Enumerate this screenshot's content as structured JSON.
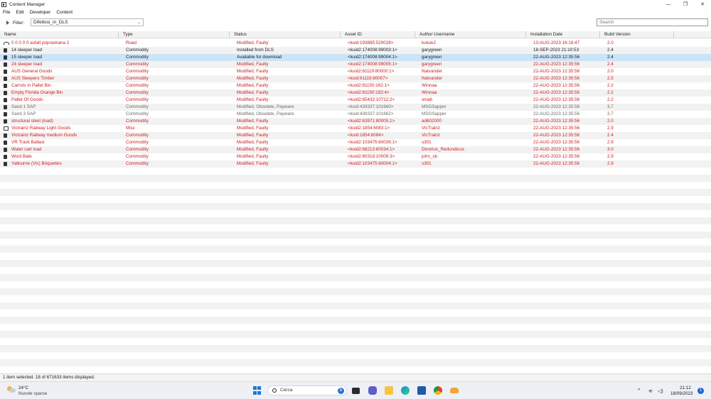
{
  "window": {
    "title": "Content Manager",
    "controls": {
      "minimize": "—",
      "maximize": "❐",
      "close": "✕"
    }
  },
  "menu": [
    "File",
    "Edit",
    "Developer",
    "Content"
  ],
  "filter": {
    "label": "Filter:",
    "value": "Difettosi_in_DLS",
    "search_placeholder": "Search"
  },
  "columns": [
    "Name",
    "Type",
    "Status",
    "Asset ID",
    "Author Username",
    "Installation Date",
    "Build Version"
  ],
  "colors": {
    "faulty": "#d21a1a",
    "normal": "#1a1a1a",
    "obsolete": "#6a6a6a",
    "selected": "#cce4f7"
  },
  "rows": [
    {
      "name": "0 0 0 0 0 asfalt popraskana 2",
      "type": "Road",
      "status": "Modified, Faulty",
      "asset_id": "<kuid:193885:520028>",
      "author": "kukuk2",
      "date": "13-AUG-2023 16:16:47",
      "version": "2.0",
      "icon": "road-icon",
      "color": "faulty"
    },
    {
      "name": "14 sleeper load",
      "type": "Commodity",
      "status": "Installed from DLS",
      "asset_id": "<kuid2:174008:99003:1>",
      "author": "garygreen",
      "date": "18-SEP-2023 21:10:53",
      "version": "2.4",
      "icon": "commodity-icon",
      "color": "normal"
    },
    {
      "name": "15 sleeper load",
      "type": "Commodity",
      "status": "Available for download",
      "asset_id": "<kuid2:174008:99004:1>",
      "author": "garygreen",
      "date": "22-AUG-2023 12:35:56",
      "version": "2.4",
      "icon": "commodity-icon",
      "color": "normal",
      "selected": true
    },
    {
      "name": "24 sleeper load",
      "type": "Commodity",
      "status": "Modified, Faulty",
      "asset_id": "<kuid2:174008:99005:1>",
      "author": "garygreen",
      "date": "22-AUG-2023 12:35:56",
      "version": "2.4",
      "icon": "commodity-icon",
      "color": "faulty"
    },
    {
      "name": "AUS General Goods",
      "type": "Commodity",
      "status": "Modified, Faulty",
      "asset_id": "<kuid2:61119:80000:1>",
      "author": "Natvander",
      "date": "22-AUG-2023 12:35:56",
      "version": "2.0",
      "icon": "commodity-icon",
      "color": "faulty"
    },
    {
      "name": "AUS Sleepers Timber",
      "type": "Commodity",
      "status": "Modified, Faulty",
      "asset_id": "<kuid:61119:80007>",
      "author": "Natvander",
      "date": "22-AUG-2023 12:35:56",
      "version": "2.5",
      "icon": "commodity-icon",
      "color": "faulty"
    },
    {
      "name": "Carrots in Pallet Bin",
      "type": "Commodity",
      "status": "Modified, Faulty",
      "asset_id": "<kuid2:81150:162:1>",
      "author": "Winnaa",
      "date": "22-AUG-2023 12:35:56",
      "version": "2.2",
      "icon": "commodity-icon",
      "color": "faulty"
    },
    {
      "name": "Empty Florida Orange Bin",
      "type": "Commodity",
      "status": "Modified, Faulty",
      "asset_id": "<kuid2:81150:192:4>",
      "author": "Winnaa",
      "date": "22-AUG-2023 12:35:56",
      "version": "2.2",
      "icon": "commodity-icon",
      "color": "faulty"
    },
    {
      "name": "Pallet Of Goods",
      "type": "Commodity",
      "status": "Modified, Faulty",
      "asset_id": "<kuid2:65432:10712:2>",
      "author": "sinab",
      "date": "22-AUG-2023 12:35:56",
      "version": "2.2",
      "icon": "commodity-icon",
      "color": "faulty"
    },
    {
      "name": "Sand 1 SAP",
      "type": "Commodity",
      "status": "Modified, Obsolete, Payware",
      "asset_id": "<kuid:439337:101660>",
      "author": "MSGSapper",
      "date": "22-AUG-2023 12:35:56",
      "version": "3.7",
      "icon": "commodity-icon",
      "color": "obsolete"
    },
    {
      "name": "Sand 3 SAP",
      "type": "Commodity",
      "status": "Modified, Obsolete, Payware",
      "asset_id": "<kuid:439337:101662>",
      "author": "MSGSapper",
      "date": "22-AUG-2023 12:35:56",
      "version": "3.7",
      "icon": "commodity-icon",
      "color": "obsolete"
    },
    {
      "name": "structural steel (load)",
      "type": "Commodity",
      "status": "Modified, Faulty",
      "asset_id": "<kuid2:63971:80005:1>",
      "author": "ad602000",
      "date": "22-AUG-2023 12:35:56",
      "version": "2.0",
      "icon": "commodity-icon",
      "color": "faulty"
    },
    {
      "name": "Victrainz Railway Light Goods",
      "type": "Misc",
      "status": "Modified, Faulty",
      "asset_id": "<kuid2:1854:6083:1>",
      "author": "VicTrainz",
      "date": "22-AUG-2023 12:35:56",
      "version": "2.9",
      "icon": "misc-icon",
      "color": "faulty"
    },
    {
      "name": "Victrainz Railway medium Goods",
      "type": "Commodity",
      "status": "Modified, Faulty",
      "asset_id": "<kuid:1854:6084>",
      "author": "VicTrainz",
      "date": "22-AUG-2023 12:35:56",
      "version": "2.4",
      "icon": "commodity-icon",
      "color": "faulty"
    },
    {
      "name": "VR Track Ballast",
      "type": "Commodity",
      "status": "Modified, Faulty",
      "asset_id": "<kuid2:103475:60026:1>",
      "author": "s301",
      "date": "22-AUG-2023 12:35:56",
      "version": "2.9",
      "icon": "commodity-icon",
      "color": "faulty"
    },
    {
      "name": "Water cart load",
      "type": "Commodity",
      "status": "Modified, Faulty",
      "asset_id": "<kuid2:68213:60034:1>",
      "author": "Dinorius_Redundicus",
      "date": "22-AUG-2023 12:35:56",
      "version": "3.0",
      "icon": "commodity-icon",
      "color": "faulty"
    },
    {
      "name": "Wool Bale",
      "type": "Commodity",
      "status": "Modified, Faulty",
      "asset_id": "<kuid2:60318:10009:3>",
      "author": "john_sb",
      "date": "22-AUG-2023 12:35:56",
      "version": "2.9",
      "icon": "commodity-icon",
      "color": "faulty"
    },
    {
      "name": "Yallourne (Vic) Briquettes",
      "type": "Commodity",
      "status": "Modified, Faulty",
      "asset_id": "<kuid2:103475:60004:1>",
      "author": "s301",
      "date": "22-AUG-2023 12:35:56",
      "version": "2.9",
      "icon": "commodity-icon",
      "color": "faulty"
    }
  ],
  "statusbar": {
    "text": "1 item selected. 18 of 671633 items displayed."
  },
  "taskbar": {
    "weather_temp": "24°C",
    "weather_desc": "Nuvole sparse",
    "search_label": "Cerca",
    "search_badge": "b",
    "clock_time": "21:12",
    "clock_date": "18/09/2023",
    "notifications": "1",
    "tray_chevron": "^",
    "tray_wifi": "≋",
    "tray_volume": "◁)"
  }
}
